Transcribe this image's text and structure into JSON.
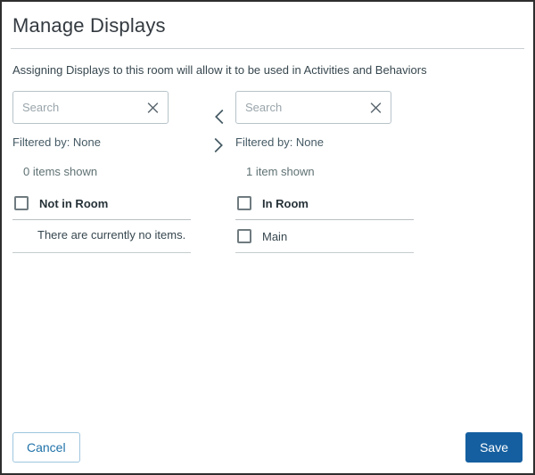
{
  "dialog": {
    "title": "Manage Displays",
    "description": "Assigning Displays to this room will allow it to be used in Activities and Behaviors"
  },
  "left_panel": {
    "search_placeholder": "Search",
    "search_value": "",
    "filtered_by": "Filtered by: None",
    "items_shown": "0 items shown",
    "header": "Not in Room",
    "empty_text": "There are currently no items."
  },
  "right_panel": {
    "search_placeholder": "Search",
    "search_value": "",
    "filtered_by": "Filtered by: None",
    "items_shown": "1 item shown",
    "header": "In Room",
    "items": [
      "Main"
    ]
  },
  "icons": {
    "clear": "x-icon",
    "move_to_left": "chevron-left-icon",
    "move_to_right": "chevron-right-icon"
  },
  "footer": {
    "cancel_label": "Cancel",
    "save_label": "Save"
  },
  "colors": {
    "primary_blue": "#155fa0",
    "cancel_border_blue": "#9fc6de",
    "cancel_text_blue": "#1f72a8",
    "divider_gray": "#c9ced1"
  }
}
